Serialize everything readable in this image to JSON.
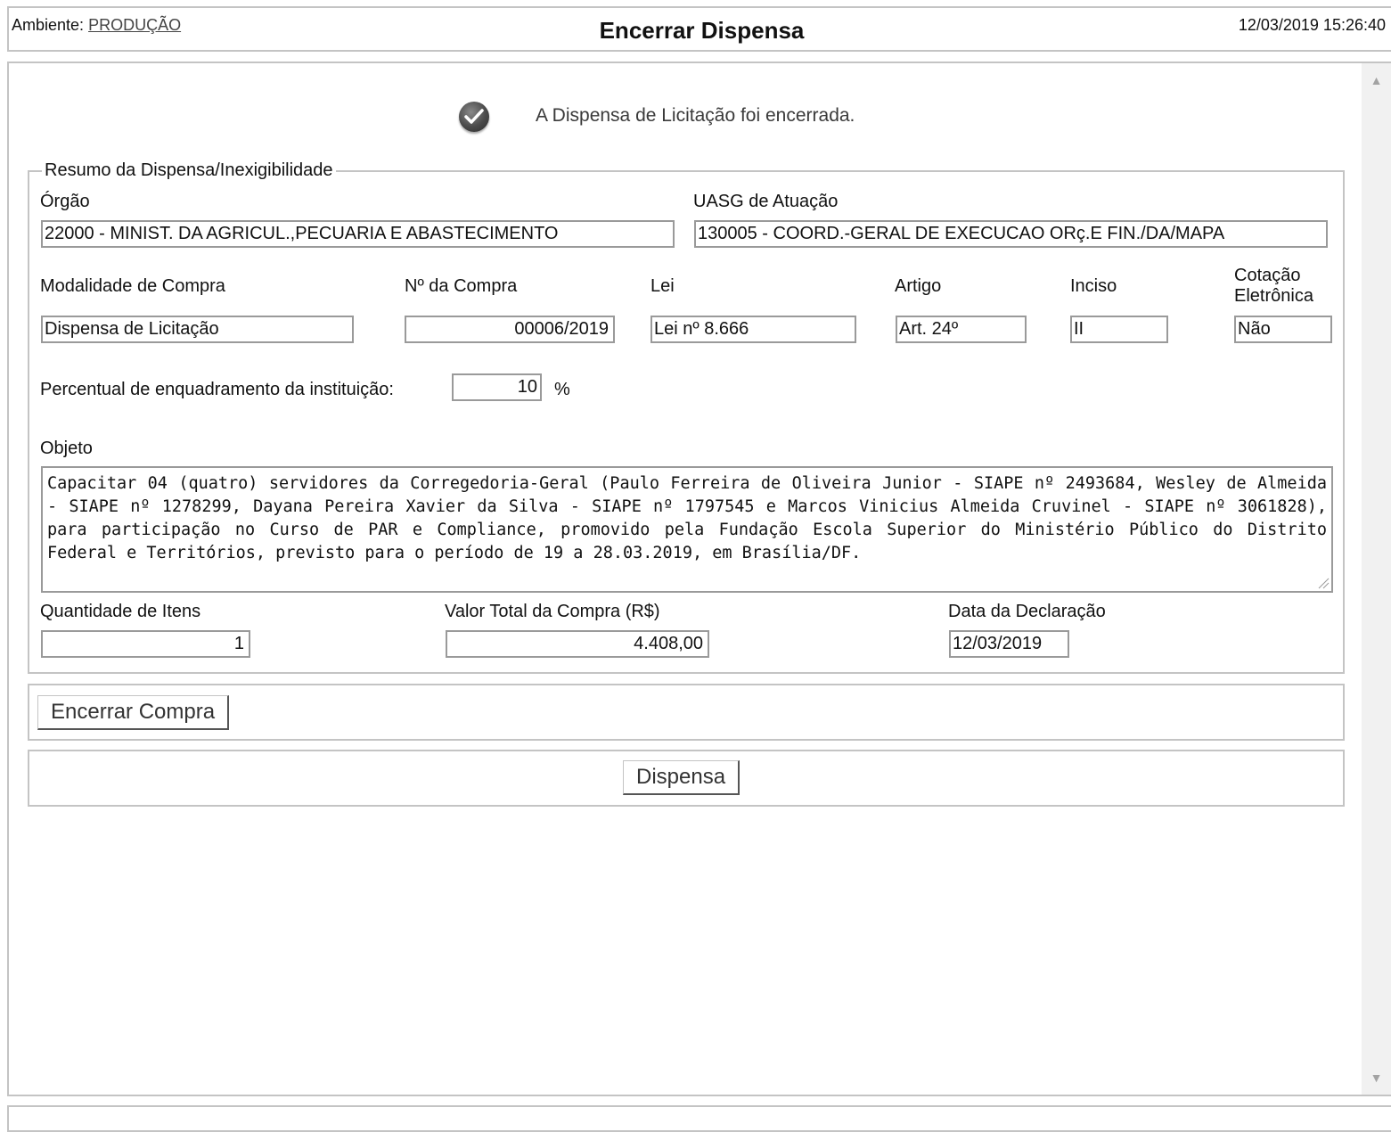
{
  "header": {
    "env_label": "Ambiente:",
    "env_value": "PRODUÇÃO",
    "title": "Encerrar Dispensa",
    "datetime": "12/03/2019 15:26:40"
  },
  "message": "A Dispensa de Licitação foi encerrada.",
  "summary": {
    "legend": "Resumo da Dispensa/Inexigibilidade",
    "orgao_label": "Órgão",
    "orgao_value": "22000 - MINIST. DA AGRICUL.,PECUARIA E ABASTECIMENTO",
    "uasg_label": "UASG de Atuação",
    "uasg_value": "130005 - COORD.-GERAL DE EXECUCAO ORç.E FIN./DA/MAPA",
    "modalidade_label": "Modalidade de Compra",
    "modalidade_value": "Dispensa de Licitação",
    "numero_label": "Nº da Compra",
    "numero_value": "00006/2019",
    "lei_label": "Lei",
    "lei_value": "Lei nº 8.666",
    "artigo_label": "Artigo",
    "artigo_value": "Art. 24º",
    "inciso_label": "Inciso",
    "inciso_value": "II",
    "cotacao_label_1": "Cotação",
    "cotacao_label_2": "Eletrônica",
    "cotacao_value": "Não",
    "percentual_label": "Percentual de enquadramento da instituição:",
    "percentual_value": "10",
    "percentual_unit": "%",
    "objeto_label": "Objeto",
    "objeto_value": "Capacitar 04 (quatro) servidores da Corregedoria-Geral (Paulo Ferreira de Oliveira Junior - SIAPE nº 2493684, Wesley de Almeida - SIAPE nº 1278299, Dayana Pereira Xavier da Silva - SIAPE nº 1797545 e Marcos Vinicius Almeida Cruvinel - SIAPE nº 3061828), para participação no Curso de PAR e Compliance, promovido pela Fundação Escola Superior do Ministério Público do Distrito Federal e Territórios, previsto para o período de 19 a 28.03.2019, em Brasília/DF.",
    "quantidade_label": "Quantidade de Itens",
    "quantidade_value": "1",
    "valor_label": "Valor Total da Compra (R$)",
    "valor_value": "4.408,00",
    "data_label": "Data da Declaração",
    "data_value": "12/03/2019"
  },
  "buttons": {
    "encerrar": "Encerrar Compra",
    "dispensa": "Dispensa"
  },
  "icons": {
    "success": "check-circle-icon",
    "scroll_up": "triangle-up-icon",
    "scroll_down": "triangle-down-icon",
    "resize": "resize-grip-icon"
  }
}
